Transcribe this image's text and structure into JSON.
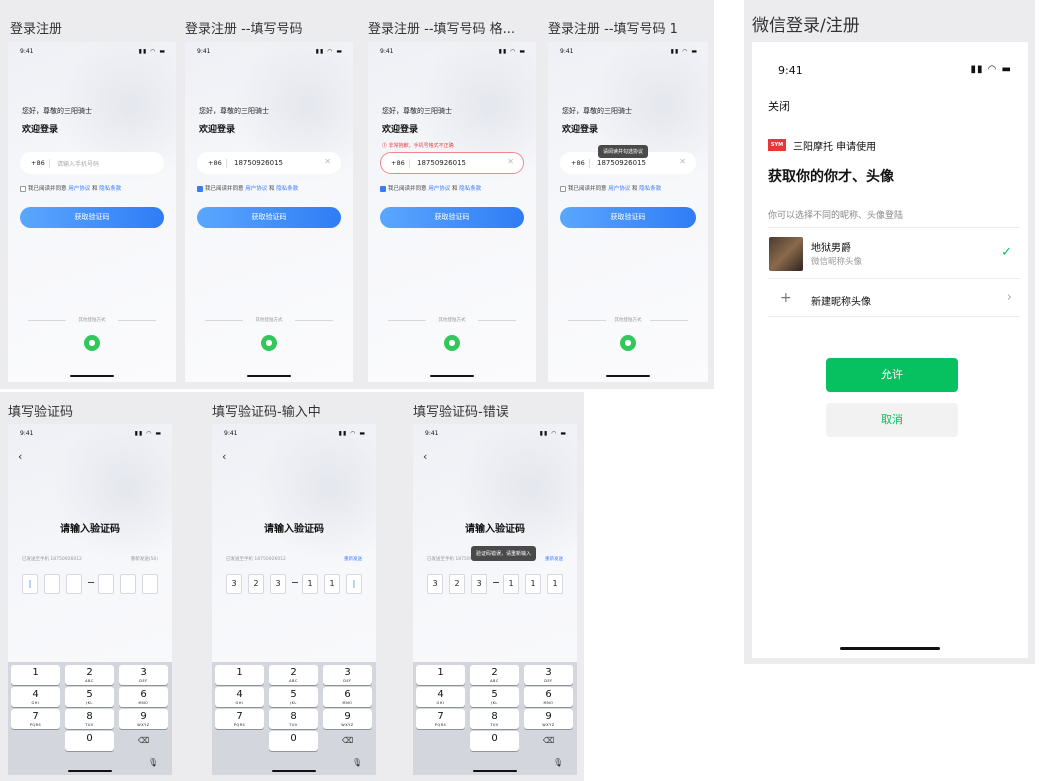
{
  "status_time": "9:41",
  "status_icons": "▮▮ ◠ ▬",
  "login_frames": [
    {
      "title": "登录注册",
      "greeting": "您好，尊敬的三阳骑士",
      "welcome": "欢迎登录",
      "country_code": "+86",
      "placeholder": "请输入手机号码",
      "phone": "",
      "agree_prefix": "我已阅读并同意",
      "user_agreement": "用户协议",
      "and": "和",
      "privacy": "隐私条款",
      "button": "获取验证码",
      "other_login": "其他登陆方式"
    },
    {
      "title": "登录注册 --填写号码",
      "greeting": "您好，尊敬的三阳骑士",
      "welcome": "欢迎登录",
      "country_code": "+86",
      "placeholder": "",
      "phone": "18750926015",
      "agree_prefix": "我已阅读并同意",
      "user_agreement": "用户协议",
      "and": "和",
      "privacy": "隐私条款",
      "button": "获取验证码",
      "other_login": "其他登陆方式"
    },
    {
      "title": "登录注册 --填写号码 格...",
      "greeting": "您好，尊敬的三阳骑士",
      "welcome": "欢迎登录",
      "country_code": "+86",
      "placeholder": "",
      "phone": "18750926015",
      "error": "⓵ 非常抱歉，手机号格式不正确",
      "agree_prefix": "我已阅读并同意",
      "user_agreement": "用户协议",
      "and": "和",
      "privacy": "隐私条款",
      "button": "获取验证码",
      "other_login": "其他登陆方式"
    },
    {
      "title": "登录注册 --填写号码 1",
      "greeting": "您好，尊敬的三阳骑士",
      "welcome": "欢迎登录",
      "country_code": "+86",
      "placeholder": "",
      "phone": "18750926015",
      "tooltip": "请阅读并勾选协议",
      "agree_prefix": "我已阅读并同意",
      "user_agreement": "用户协议",
      "and": "和",
      "privacy": "隐私条款",
      "button": "获取验证码",
      "other_login": "其他登陆方式"
    }
  ],
  "verify_frames": [
    {
      "title": "填写验证码",
      "heading": "请输入验证码",
      "sent_to": "已发送至手机 18750926012",
      "resend": "重新发送(56)",
      "codes": [
        "|",
        "",
        "",
        "",
        "",
        ""
      ]
    },
    {
      "title": "填写验证码-输入中",
      "heading": "请输入验证码",
      "sent_to": "已发送至手机 18750926012",
      "resend": "重新发送",
      "codes": [
        "3",
        "2",
        "3",
        "1",
        "1",
        "|"
      ]
    },
    {
      "title": "填写验证码-错误",
      "heading": "请输入验证码",
      "sent_to": "已发送至手机 18750926012",
      "resend": "重新发送",
      "toast": "验证码错误，请重新输入",
      "codes": [
        "3",
        "2",
        "3",
        "1",
        "1",
        "1"
      ]
    }
  ],
  "keypad": [
    {
      "n": "1",
      "l": ""
    },
    {
      "n": "2",
      "l": "ABC"
    },
    {
      "n": "3",
      "l": "DEF"
    },
    {
      "n": "4",
      "l": "GHI"
    },
    {
      "n": "5",
      "l": "JKL"
    },
    {
      "n": "6",
      "l": "MNO"
    },
    {
      "n": "7",
      "l": "PQRS"
    },
    {
      "n": "8",
      "l": "TUV"
    },
    {
      "n": "9",
      "l": "WXYZ"
    },
    {
      "n": "0",
      "l": ""
    }
  ],
  "keypad_delete_icon": "⌫",
  "keypad_mic_icon": "🎙",
  "wechat": {
    "panel_title": "微信登录/注册",
    "time": "9:41",
    "close": "关闭",
    "app_logo_text": "SYM",
    "app_request": "三阳摩托 申请使用",
    "heading": "获取你的你才、头像",
    "hint": "你可以选择不同的昵称、头像登陆",
    "nickname": "地狱男爵",
    "nickname_sub": "微信昵称头像",
    "check_icon": "✓",
    "plus_icon": "+",
    "new_nickname": "新建昵称头像",
    "chevron_icon": "›",
    "allow": "允许",
    "cancel": "取消"
  },
  "colors": {
    "accent_blue": "#3a7bff",
    "wechat_green": "#07c160",
    "error_red": "#e54545"
  }
}
